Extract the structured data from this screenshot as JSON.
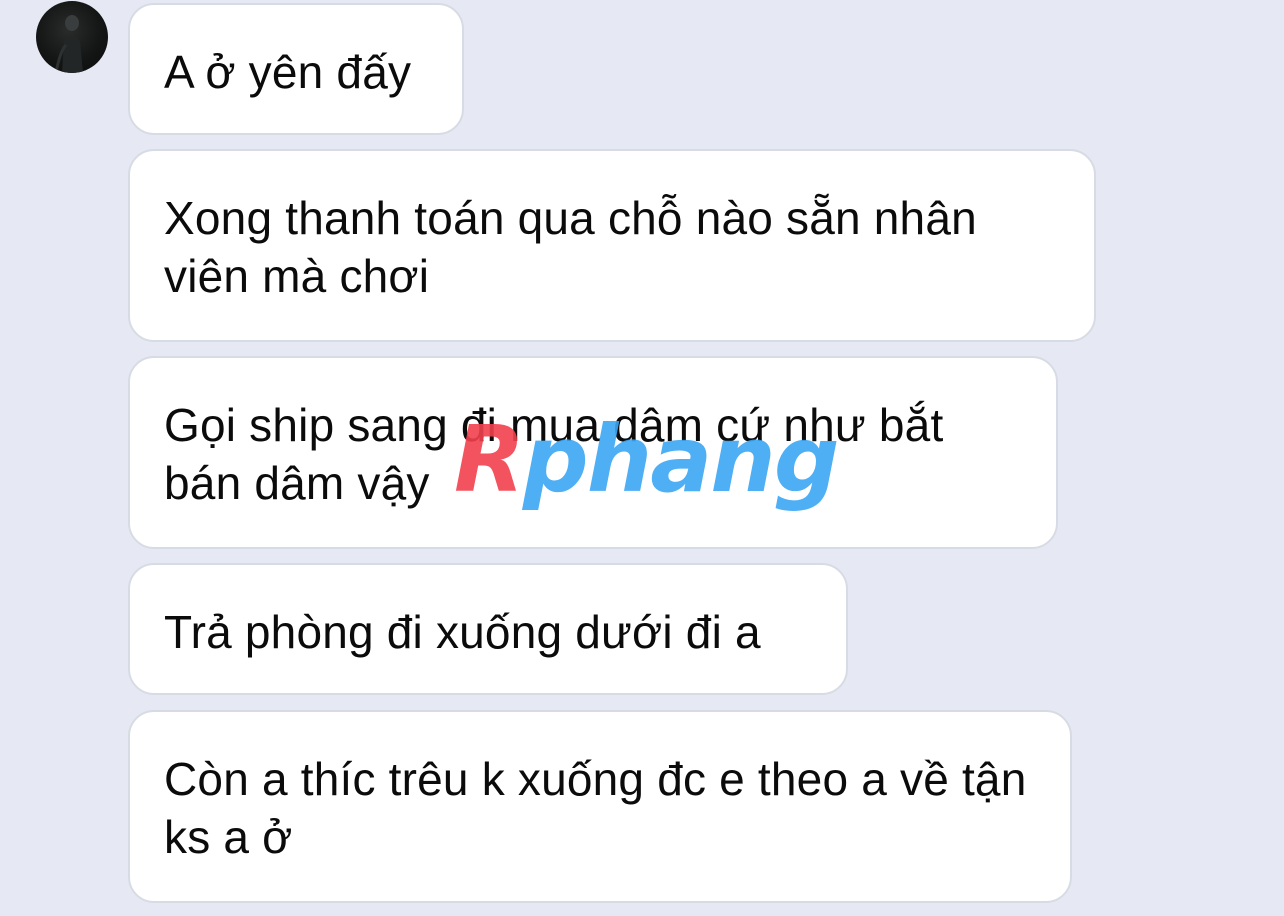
{
  "conversation": {
    "messages": [
      {
        "text": "A ở yên đấy"
      },
      {
        "text": "Xong thanh toán qua chỗ nào sẵn nhân viên mà chơi"
      },
      {
        "text": "Gọi ship sang đi mua dâm cứ như bắt bán dâm vậy"
      },
      {
        "text": "Trả phòng đi xuống dưới đi a"
      },
      {
        "text": "Còn a thíc trêu k xuống đc e theo a về tận ks a ở"
      }
    ]
  },
  "watermark": {
    "text": "Rphang",
    "colors": {
      "first": "#f2414e",
      "rest": "#3ba7f5"
    }
  },
  "colors": {
    "background": "#e6e9f3",
    "bubble": "#ffffff",
    "bubble_border": "#d7dbe4",
    "text": "#0b0b0b"
  },
  "icons": {
    "avatar": "contact-avatar"
  }
}
